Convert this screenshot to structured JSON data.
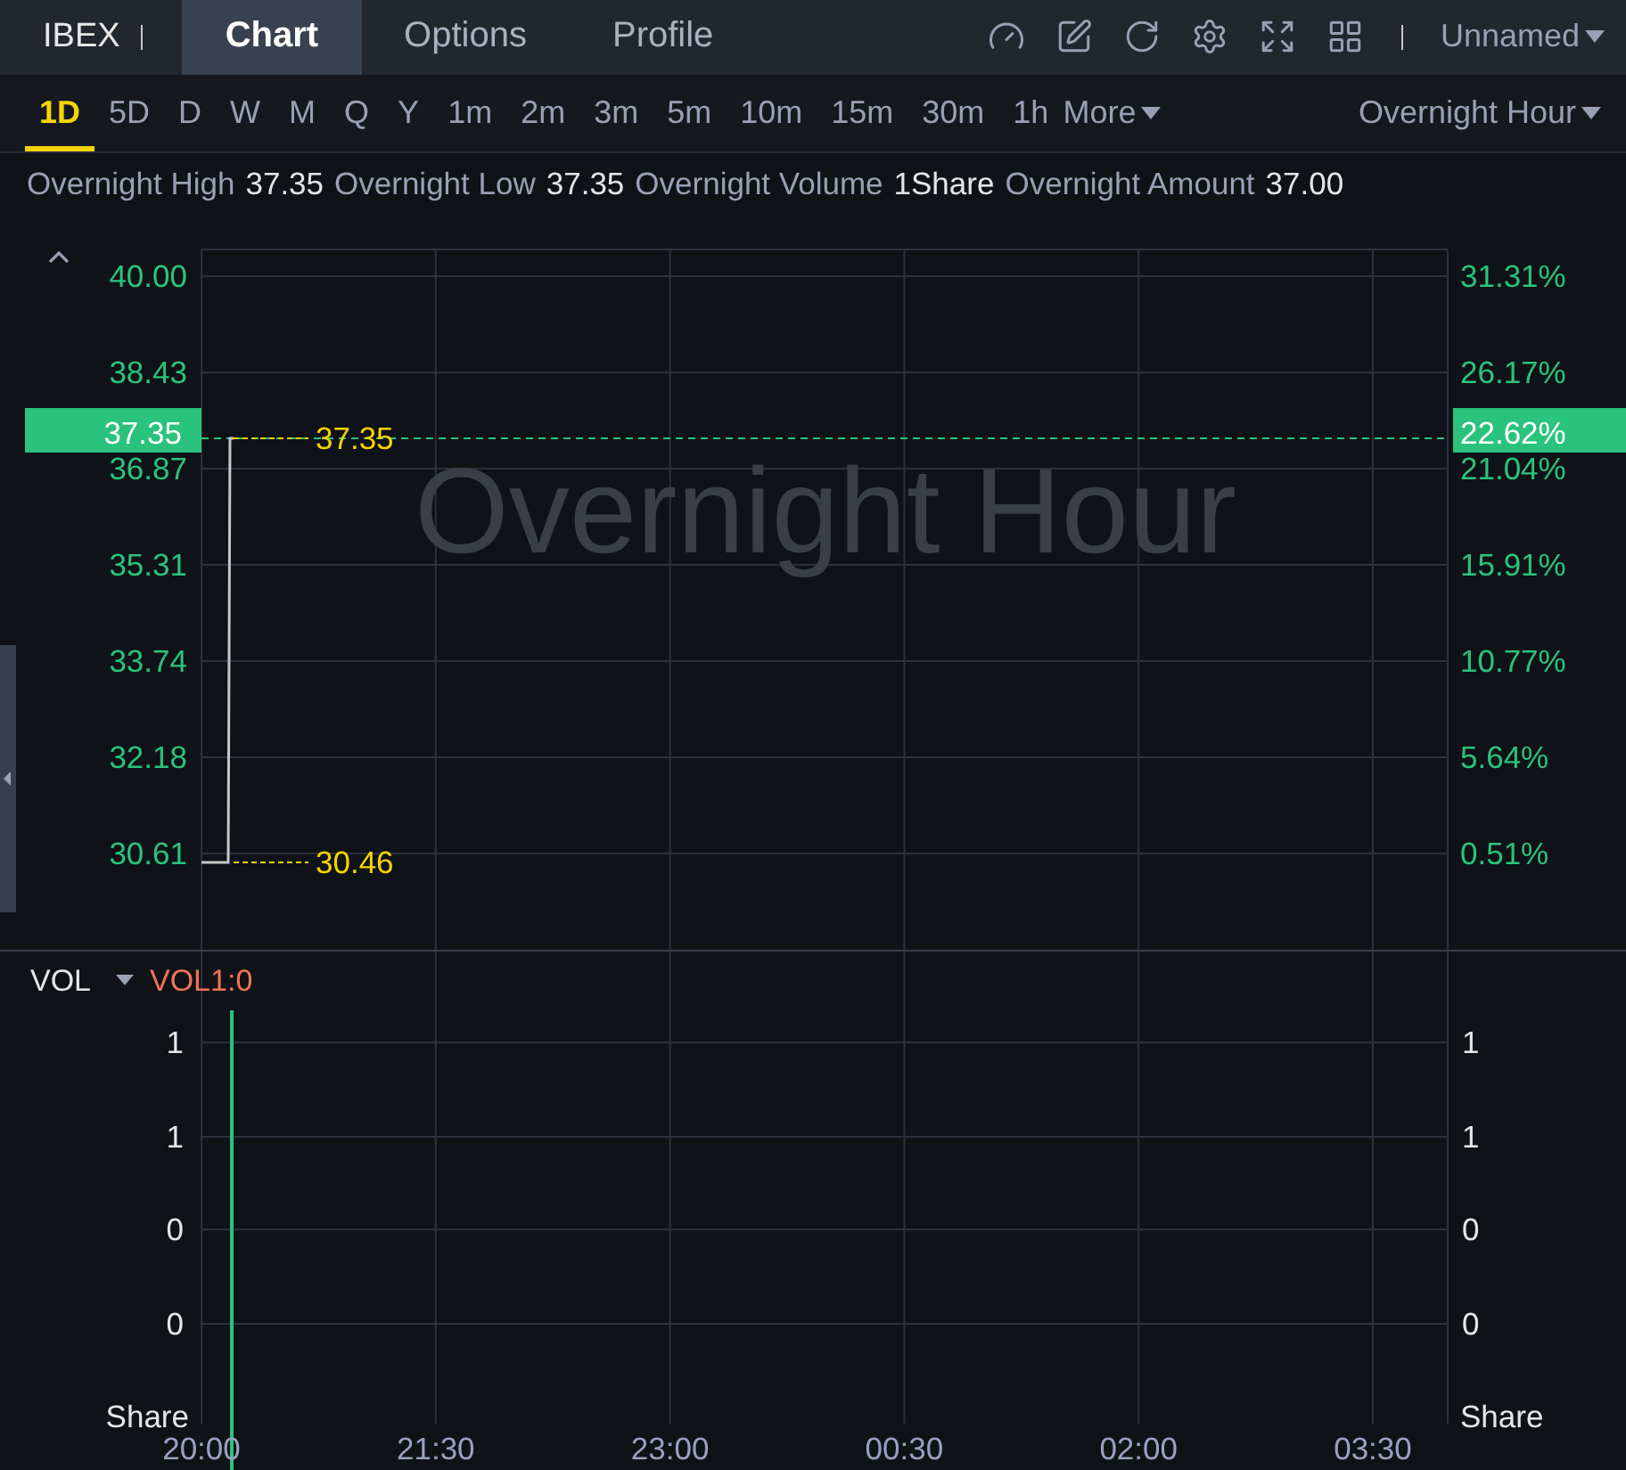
{
  "header": {
    "symbol": "IBEX",
    "tabs": [
      {
        "label": "Chart",
        "selected": true
      },
      {
        "label": "Options",
        "selected": false
      },
      {
        "label": "Profile",
        "selected": false
      }
    ],
    "layout_name": "Unnamed"
  },
  "periods": [
    {
      "label": "1D",
      "selected": true
    },
    {
      "label": "5D",
      "selected": false
    },
    {
      "label": "D",
      "selected": false
    },
    {
      "label": "W",
      "selected": false
    },
    {
      "label": "M",
      "selected": false
    },
    {
      "label": "Q",
      "selected": false
    },
    {
      "label": "Y",
      "selected": false
    },
    {
      "label": "1m",
      "selected": false
    },
    {
      "label": "2m",
      "selected": false
    },
    {
      "label": "3m",
      "selected": false
    },
    {
      "label": "5m",
      "selected": false
    },
    {
      "label": "10m",
      "selected": false
    },
    {
      "label": "15m",
      "selected": false
    },
    {
      "label": "30m",
      "selected": false
    },
    {
      "label": "1h",
      "selected": false
    }
  ],
  "more_label": "More",
  "session": "Overnight Hour",
  "stats": [
    {
      "label": "Overnight High",
      "value": "37.35"
    },
    {
      "label": "Overnight Low",
      "value": "37.35"
    },
    {
      "label": "Overnight Volume",
      "value": "1Share"
    },
    {
      "label": "Overnight Amount",
      "value": "37.00"
    }
  ],
  "price_chart": {
    "watermark": "Overnight Hour",
    "current_price": "37.35",
    "current_change": "22.62%",
    "right_labels": [
      "31.31%",
      "26.17%",
      "21.04%",
      "15.91%",
      "10.77%",
      "5.64%",
      "0.51%"
    ],
    "price_labels": [
      "40.00",
      "38.43",
      "36.87",
      "35.31",
      "33.74",
      "32.18",
      "30.61"
    ],
    "time_labels": [
      "20:00",
      "21:30",
      "23:00",
      "00:30",
      "02:00",
      "03:30"
    ],
    "high_label": "37.35",
    "low_label": "30.46"
  },
  "volume_chart": {
    "name": "VOL",
    "reading": "VOL1:0",
    "left_labels": [
      "1",
      "1",
      "0",
      "0"
    ],
    "right_labels": [
      "1",
      "1",
      "0",
      "0"
    ],
    "units": [
      "Share",
      "Share"
    ]
  }
}
